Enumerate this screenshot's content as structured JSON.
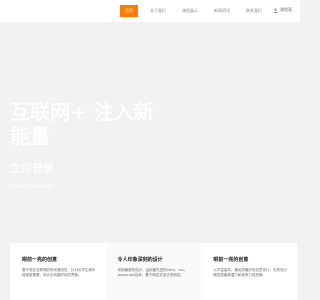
{
  "nav": {
    "items": [
      {
        "label": "首页",
        "active": true
      },
      {
        "label": "关于我们",
        "active": false
      },
      {
        "label": "课程展示",
        "active": false
      },
      {
        "label": "新闻资讯",
        "active": false
      },
      {
        "label": "联系我们",
        "active": false
      }
    ],
    "user_label": "课程表",
    "accent_color": "#ff7a00"
  },
  "hero": {
    "title": "互联网+ 注入新能量",
    "cta": "立即登录",
    "subtitle": "LOREM IPSUM DOLOR"
  },
  "features": [
    {
      "title": "眼前一亮的创意",
      "desc": "基于现在互联网的时尚潮流性，针对大学生和年轻家庭需要，设计出有趣好玩的界面。"
    },
    {
      "title": "令人印象深刻的设计",
      "desc": "采用最新的设计，运用最先进的html、css、javascript技术，基于响应式设计的网站。"
    },
    {
      "title": "眼前一亮的创意",
      "desc": "以丰富高效、最优质最好的创意设计，为您充分展现您最具潜力和竞争力的品牌。"
    }
  ]
}
